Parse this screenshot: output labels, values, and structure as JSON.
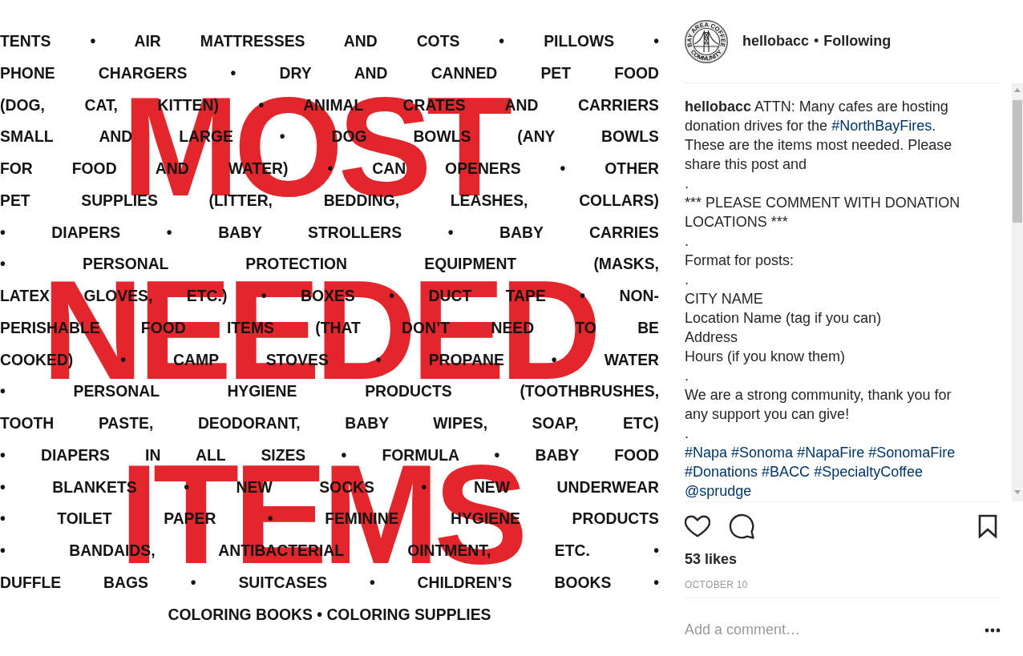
{
  "post_image": {
    "headline": [
      "MOST",
      "NEEDED",
      "ITEMS"
    ],
    "lines": [
      "TENTS • AIR MATTRESSES AND COTS • PILLOWS •",
      "PHONE CHARGERS • DRY AND CANNED PET FOOD",
      "(DOG, CAT, KITTEN) • ANIMAL CRATES AND CARRIERS",
      "SMALL AND LARGE • DOG BOWLS (ANY BOWLS",
      "FOR FOOD AND WATER) • CAN OPENERS • OTHER",
      "PET SUPPLIES (LITTER, BEDDING, LEASHES, COLLARS)",
      "• DIAPERS • BABY STROLLERS • BABY CARRIES",
      "• PERSONAL PROTECTION EQUIPMENT (MASKS,",
      "LATEX GLOVES, ETC.) • BOXES • DUCT TAPE • NON-",
      "PERISHABLE FOOD ITEMS (THAT DON’T NEED TO BE",
      "COOKED) • CAMP STOVES • PROPANE • WATER",
      "• PERSONAL HYGIENE PRODUCTS (TOOTHBRUSHES,",
      "TOOTH PASTE, DEODORANT, BABY WIPES, SOAP, ETC)",
      "• DIAPERS IN ALL SIZES • FORMULA • BABY FOOD",
      "• BLANKETS • NEW SOCKS • NEW UNDERWEAR",
      "• TOILET PAPER • FEMININE HYGIENE PRODUCTS",
      "• BANDAIDS, ANTIBACTERIAL OINTMENT, ETC. •",
      "DUFFLE BAGS • SUITCASES • CHILDREN’S BOOKS •"
    ],
    "closing_line": "COLORING BOOKS • COLORING SUPPLIES"
  },
  "header": {
    "avatar": {
      "ring_text_top": "BAY AREA COFFEE",
      "ring_text_bottom": "COMMUNITY"
    },
    "username": "hellobacc",
    "separator": "•",
    "follow_button": "Following"
  },
  "caption": {
    "paragraphs": [
      [
        {
          "kind": "user",
          "text": "hellobacc"
        },
        {
          "kind": "text",
          "text": " ATTN: Many cafes are hosting donation drives for the "
        },
        {
          "kind": "hashtag",
          "text": "#NorthBayFires"
        },
        {
          "kind": "text",
          "text": ". These are the items most needed. Please share this post and"
        }
      ],
      [
        {
          "kind": "text",
          "text": "."
        }
      ],
      [
        {
          "kind": "text",
          "text": "*** PLEASE COMMENT WITH DONATION LOCATIONS ***"
        }
      ],
      [
        {
          "kind": "text",
          "text": "."
        }
      ],
      [
        {
          "kind": "text",
          "text": "Format for posts:"
        }
      ],
      [
        {
          "kind": "text",
          "text": "."
        }
      ],
      [
        {
          "kind": "text",
          "text": "CITY NAME"
        }
      ],
      [
        {
          "kind": "text",
          "text": "Location Name (tag if you can)"
        }
      ],
      [
        {
          "kind": "text",
          "text": "Address"
        }
      ],
      [
        {
          "kind": "text",
          "text": "Hours (if you know them)"
        }
      ],
      [
        {
          "kind": "text",
          "text": "."
        }
      ],
      [
        {
          "kind": "text",
          "text": "We are a strong community, thank you for any support you can give!"
        }
      ],
      [
        {
          "kind": "text",
          "text": "."
        }
      ],
      [
        {
          "kind": "hashtag",
          "text": "#Napa"
        },
        {
          "kind": "hashtag",
          "text": "#Sonoma"
        },
        {
          "kind": "hashtag",
          "text": "#NapaFire"
        },
        {
          "kind": "hashtag",
          "text": "#SonomaFire"
        },
        {
          "kind": "hashtag",
          "text": "#Donations"
        },
        {
          "kind": "hashtag",
          "text": "#BACC"
        },
        {
          "kind": "hashtag",
          "text": "#SpecialtyCoffee"
        },
        {
          "kind": "mention",
          "text": "@sprudge"
        }
      ]
    ]
  },
  "actions": {
    "liked": false,
    "saved": false
  },
  "likes": "53 likes",
  "date": "OCTOBER 10",
  "comment_field": {
    "placeholder": "Add a comment…"
  }
}
